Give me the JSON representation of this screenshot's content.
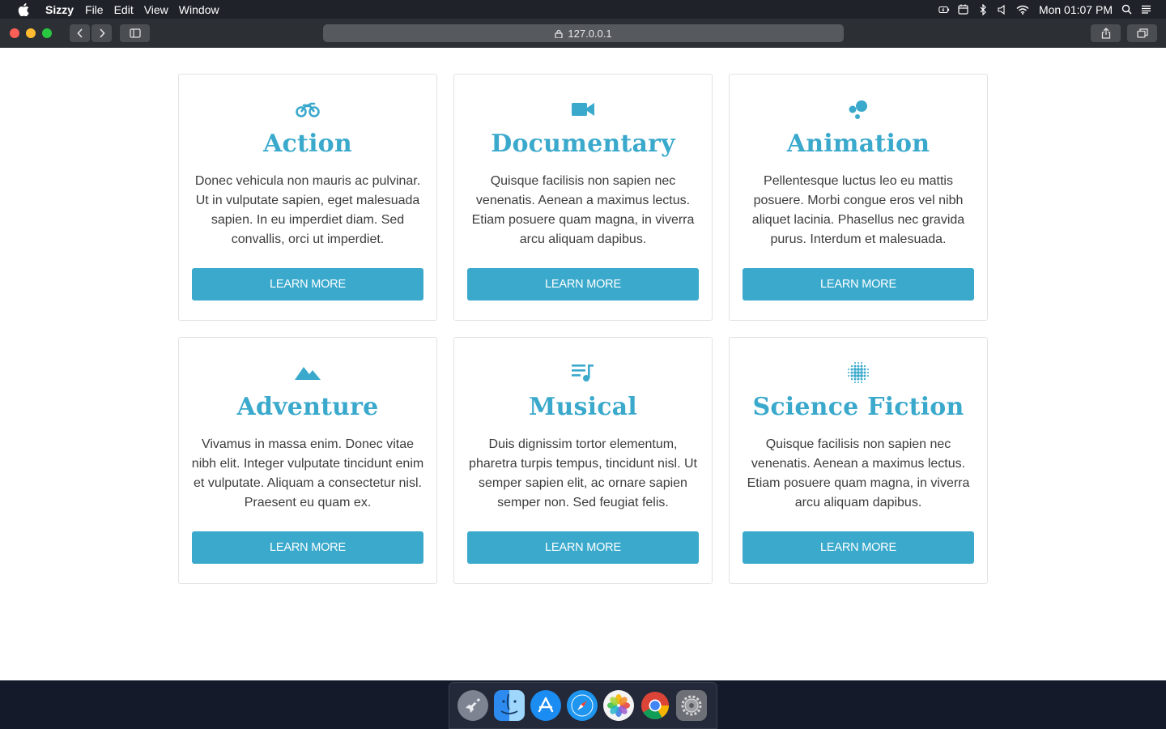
{
  "menubar": {
    "app_name": "Sizzy",
    "menus": [
      "File",
      "Edit",
      "View",
      "Window"
    ],
    "clock": "Mon 01:07 PM",
    "status_icons": [
      "battery-icon",
      "calendar-icon",
      "bluetooth-icon",
      "volume-icon",
      "wifi-icon",
      "spotlight-icon",
      "control-center-icon"
    ]
  },
  "browser": {
    "url": "127.0.0.1"
  },
  "colors": {
    "accent": "#3aa9cc",
    "text": "#3c3c3c",
    "card_border": "#e2e2e2"
  },
  "cards": [
    {
      "icon": "motorcycle-icon",
      "title": "Action",
      "text": "Donec vehicula non mauris ac pulvinar. Ut in vulputate sapien, eget malesuada sapien. In eu imperdiet diam. Sed convallis, orci ut imperdiet.",
      "button": "LEARN MORE"
    },
    {
      "icon": "video-camera-icon",
      "title": "Documentary",
      "text": "Quisque facilisis non sapien nec venenatis. Aenean a maximus lectus. Etiam posuere quam magna, in viverra arcu aliquam dapibus.",
      "button": "LEARN MORE"
    },
    {
      "icon": "bubbles-icon",
      "title": "Animation",
      "text": "Pellentesque luctus leo eu mattis posuere. Morbi congue eros vel nibh aliquet lacinia. Phasellus nec gravida purus. Interdum et malesuada.",
      "button": "LEARN MORE"
    },
    {
      "icon": "mountain-icon",
      "title": "Adventure",
      "text": "Vivamus in massa enim. Donec vitae nibh elit. Integer vulputate tincidunt enim et vulputate. Aliquam a consectetur nisl. Praesent eu quam ex.",
      "button": "LEARN MORE"
    },
    {
      "icon": "playlist-music-icon",
      "title": "Musical",
      "text": "Duis dignissim tortor elementum, pharetra turpis tempus, tincidunt nisl. Ut semper sapien elit, ac ornare sapien semper non. Sed feugiat felis.",
      "button": "LEARN MORE"
    },
    {
      "icon": "dot-sphere-icon",
      "title": "Science Fiction",
      "text": "Quisque facilisis non sapien nec venenatis. Aenean a maximus lectus. Etiam posuere quam magna, in viverra arcu aliquam dapibus.",
      "button": "LEARN MORE"
    }
  ],
  "dock": [
    "launchpad-icon",
    "finder-icon",
    "app-store-icon",
    "safari-icon",
    "photos-icon",
    "chrome-icon",
    "system-preferences-icon"
  ]
}
